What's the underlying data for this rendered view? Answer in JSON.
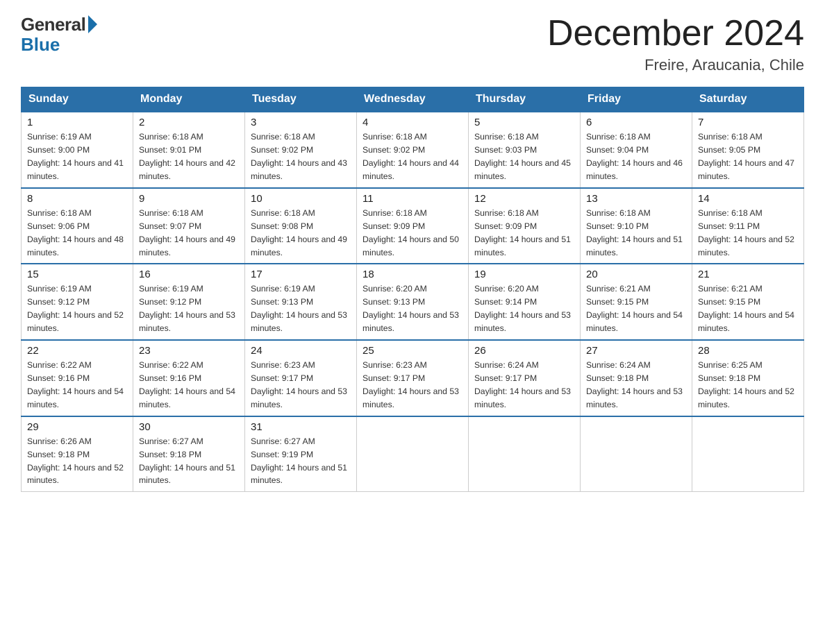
{
  "header": {
    "logo_general": "General",
    "logo_blue": "Blue",
    "month_title": "December 2024",
    "location": "Freire, Araucania, Chile"
  },
  "days_of_week": [
    "Sunday",
    "Monday",
    "Tuesday",
    "Wednesday",
    "Thursday",
    "Friday",
    "Saturday"
  ],
  "weeks": [
    [
      {
        "day": 1,
        "sunrise": "6:19 AM",
        "sunset": "9:00 PM",
        "daylight": "14 hours and 41 minutes."
      },
      {
        "day": 2,
        "sunrise": "6:18 AM",
        "sunset": "9:01 PM",
        "daylight": "14 hours and 42 minutes."
      },
      {
        "day": 3,
        "sunrise": "6:18 AM",
        "sunset": "9:02 PM",
        "daylight": "14 hours and 43 minutes."
      },
      {
        "day": 4,
        "sunrise": "6:18 AM",
        "sunset": "9:02 PM",
        "daylight": "14 hours and 44 minutes."
      },
      {
        "day": 5,
        "sunrise": "6:18 AM",
        "sunset": "9:03 PM",
        "daylight": "14 hours and 45 minutes."
      },
      {
        "day": 6,
        "sunrise": "6:18 AM",
        "sunset": "9:04 PM",
        "daylight": "14 hours and 46 minutes."
      },
      {
        "day": 7,
        "sunrise": "6:18 AM",
        "sunset": "9:05 PM",
        "daylight": "14 hours and 47 minutes."
      }
    ],
    [
      {
        "day": 8,
        "sunrise": "6:18 AM",
        "sunset": "9:06 PM",
        "daylight": "14 hours and 48 minutes."
      },
      {
        "day": 9,
        "sunrise": "6:18 AM",
        "sunset": "9:07 PM",
        "daylight": "14 hours and 49 minutes."
      },
      {
        "day": 10,
        "sunrise": "6:18 AM",
        "sunset": "9:08 PM",
        "daylight": "14 hours and 49 minutes."
      },
      {
        "day": 11,
        "sunrise": "6:18 AM",
        "sunset": "9:09 PM",
        "daylight": "14 hours and 50 minutes."
      },
      {
        "day": 12,
        "sunrise": "6:18 AM",
        "sunset": "9:09 PM",
        "daylight": "14 hours and 51 minutes."
      },
      {
        "day": 13,
        "sunrise": "6:18 AM",
        "sunset": "9:10 PM",
        "daylight": "14 hours and 51 minutes."
      },
      {
        "day": 14,
        "sunrise": "6:18 AM",
        "sunset": "9:11 PM",
        "daylight": "14 hours and 52 minutes."
      }
    ],
    [
      {
        "day": 15,
        "sunrise": "6:19 AM",
        "sunset": "9:12 PM",
        "daylight": "14 hours and 52 minutes."
      },
      {
        "day": 16,
        "sunrise": "6:19 AM",
        "sunset": "9:12 PM",
        "daylight": "14 hours and 53 minutes."
      },
      {
        "day": 17,
        "sunrise": "6:19 AM",
        "sunset": "9:13 PM",
        "daylight": "14 hours and 53 minutes."
      },
      {
        "day": 18,
        "sunrise": "6:20 AM",
        "sunset": "9:13 PM",
        "daylight": "14 hours and 53 minutes."
      },
      {
        "day": 19,
        "sunrise": "6:20 AM",
        "sunset": "9:14 PM",
        "daylight": "14 hours and 53 minutes."
      },
      {
        "day": 20,
        "sunrise": "6:21 AM",
        "sunset": "9:15 PM",
        "daylight": "14 hours and 54 minutes."
      },
      {
        "day": 21,
        "sunrise": "6:21 AM",
        "sunset": "9:15 PM",
        "daylight": "14 hours and 54 minutes."
      }
    ],
    [
      {
        "day": 22,
        "sunrise": "6:22 AM",
        "sunset": "9:16 PM",
        "daylight": "14 hours and 54 minutes."
      },
      {
        "day": 23,
        "sunrise": "6:22 AM",
        "sunset": "9:16 PM",
        "daylight": "14 hours and 54 minutes."
      },
      {
        "day": 24,
        "sunrise": "6:23 AM",
        "sunset": "9:17 PM",
        "daylight": "14 hours and 53 minutes."
      },
      {
        "day": 25,
        "sunrise": "6:23 AM",
        "sunset": "9:17 PM",
        "daylight": "14 hours and 53 minutes."
      },
      {
        "day": 26,
        "sunrise": "6:24 AM",
        "sunset": "9:17 PM",
        "daylight": "14 hours and 53 minutes."
      },
      {
        "day": 27,
        "sunrise": "6:24 AM",
        "sunset": "9:18 PM",
        "daylight": "14 hours and 53 minutes."
      },
      {
        "day": 28,
        "sunrise": "6:25 AM",
        "sunset": "9:18 PM",
        "daylight": "14 hours and 52 minutes."
      }
    ],
    [
      {
        "day": 29,
        "sunrise": "6:26 AM",
        "sunset": "9:18 PM",
        "daylight": "14 hours and 52 minutes."
      },
      {
        "day": 30,
        "sunrise": "6:27 AM",
        "sunset": "9:18 PM",
        "daylight": "14 hours and 51 minutes."
      },
      {
        "day": 31,
        "sunrise": "6:27 AM",
        "sunset": "9:19 PM",
        "daylight": "14 hours and 51 minutes."
      },
      null,
      null,
      null,
      null
    ]
  ]
}
